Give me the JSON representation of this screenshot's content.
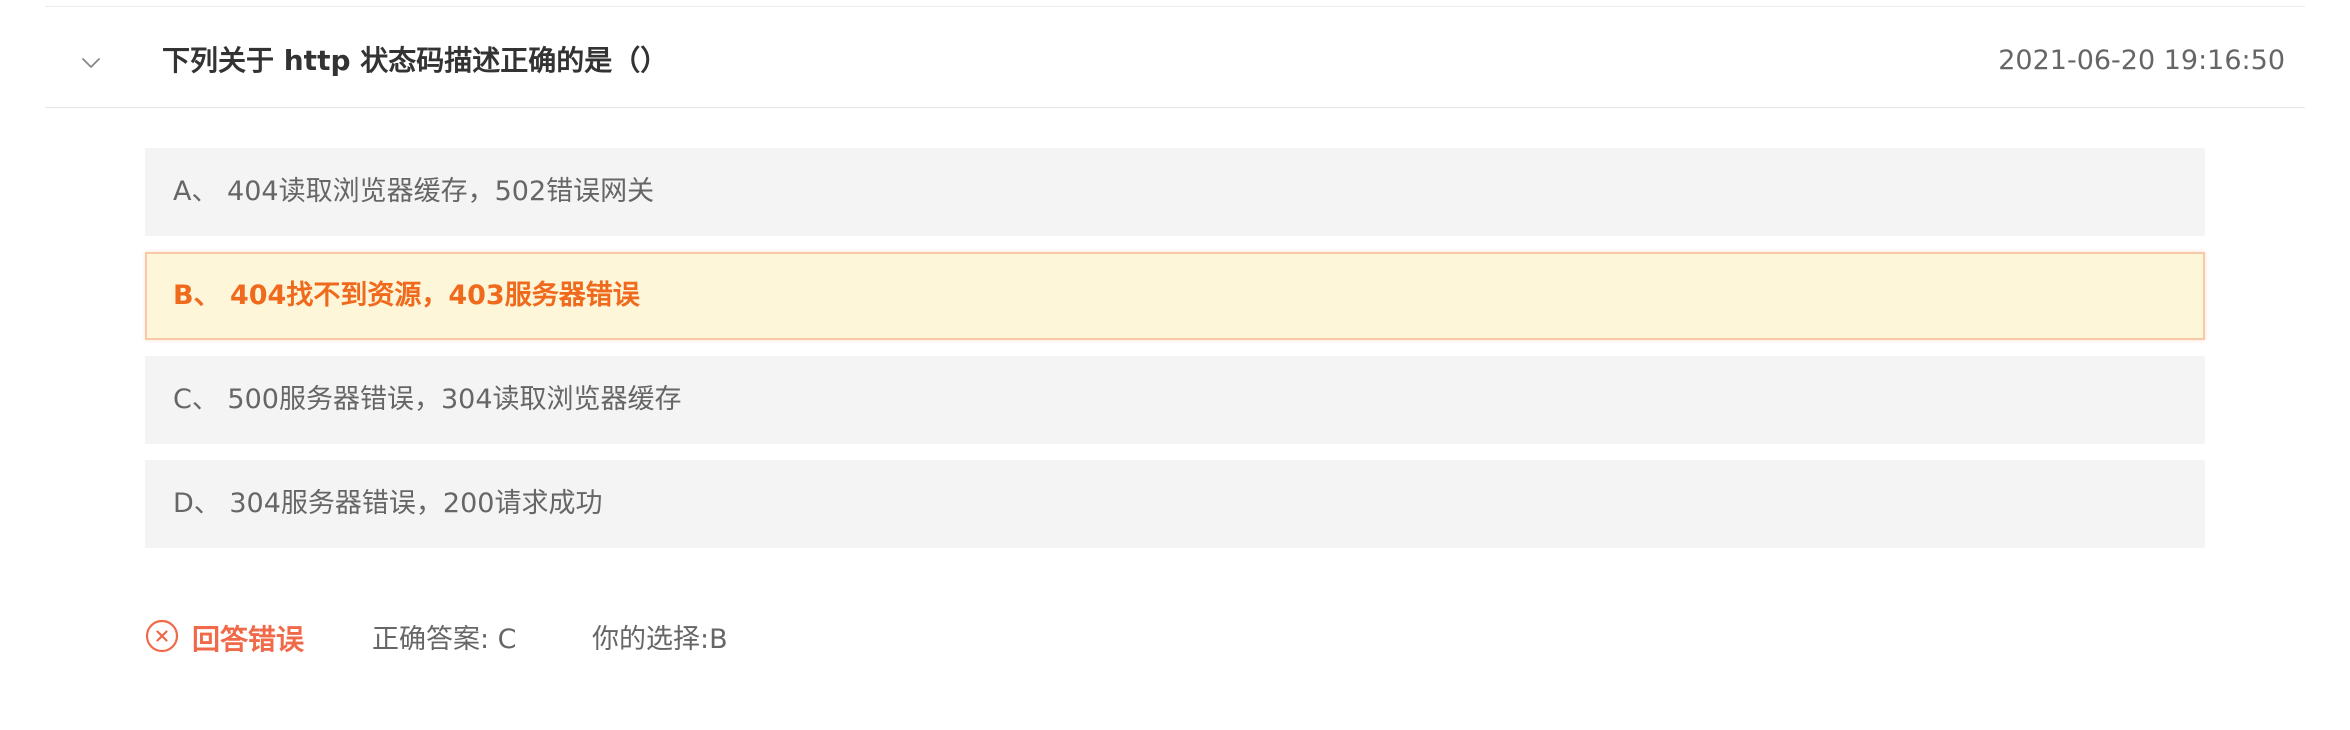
{
  "question": {
    "title": "下列关于 http 状态码描述正确的是（）",
    "timestamp": "2021-06-20 19:16:50",
    "expanded": true
  },
  "options": [
    {
      "letter": "A",
      "text": "A、 404读取浏览器缓存，502错误网关",
      "selected": false
    },
    {
      "letter": "B",
      "text": "B、 404找不到资源，403服务器错误",
      "selected": true
    },
    {
      "letter": "C",
      "text": "C、 500服务器错误，304读取浏览器缓存",
      "selected": false
    },
    {
      "letter": "D",
      "text": "D、 304服务器错误，200请求成功",
      "selected": false
    }
  ],
  "result": {
    "status_text": "回答错误",
    "status_icon": "close-circle-icon",
    "correct_answer_text": "正确答案: C",
    "your_choice_text": "你的选择:B"
  },
  "colors": {
    "title_text": "#333333",
    "body_text": "#666666",
    "option_bg": "#f4f4f4",
    "selected_bg": "#fdf6d8",
    "selected_border": "#f8c9a6",
    "selected_text": "#f06a1e",
    "error": "#f06a4a"
  }
}
